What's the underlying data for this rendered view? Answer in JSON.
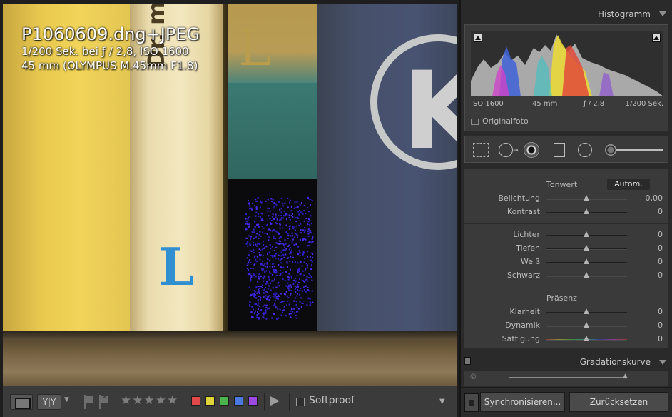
{
  "photo": {
    "filename": "P1060609.dng+JPEG",
    "exposure": "1/200 Sek. bei ƒ / 2,8, ISO 1600",
    "lens": "45 mm (OLYMPUS M.45mm F1.8)",
    "spine_text": "Dr. med. Ecka",
    "spine_letter": "L",
    "teal_letter": "L",
    "logo_letter": "K"
  },
  "toolbar": {
    "compare_label": "Y|Y",
    "stars": "★★★★★",
    "swatches": [
      {
        "name": "red",
        "color": "#e04a4a"
      },
      {
        "name": "yellow",
        "color": "#e0d43a"
      },
      {
        "name": "green",
        "color": "#4cb44c"
      },
      {
        "name": "blue",
        "color": "#4a7ae0"
      },
      {
        "name": "purple",
        "color": "#9a4ae0"
      }
    ],
    "play_icon": "▶",
    "softproof_label": "Softproof",
    "menu_icon": "▼"
  },
  "histogram": {
    "title": "Histogramm",
    "iso": "ISO 1600",
    "focal": "45 mm",
    "aperture": "ƒ / 2,8",
    "shutter": "1/200 Sek.",
    "original_label": "Originalfoto"
  },
  "basic": {
    "tone_title": "Tonwert",
    "auto_label": "Autom.",
    "presence_title": "Präsenz",
    "tone_rows": [
      {
        "label": "Belichtung",
        "value": "0,00",
        "pos": 0.5
      },
      {
        "label": "Kontrast",
        "value": "0",
        "pos": 0.5
      }
    ],
    "light_rows": [
      {
        "label": "Lichter",
        "value": "0",
        "pos": 0.5
      },
      {
        "label": "Tiefen",
        "value": "0",
        "pos": 0.5
      },
      {
        "label": "Weiß",
        "value": "0",
        "pos": 0.5
      },
      {
        "label": "Schwarz",
        "value": "0",
        "pos": 0.5
      }
    ],
    "presence_rows": [
      {
        "label": "Klarheit",
        "value": "0",
        "pos": 0.5
      },
      {
        "label": "Dynamik",
        "value": "0",
        "pos": 0.5
      },
      {
        "label": "Sättigung",
        "value": "0",
        "pos": 0.5
      }
    ]
  },
  "curve": {
    "title": "Gradationskurve"
  },
  "footer": {
    "sync_label": "Synchronisieren...",
    "reset_label": "Zurücksetzen"
  }
}
